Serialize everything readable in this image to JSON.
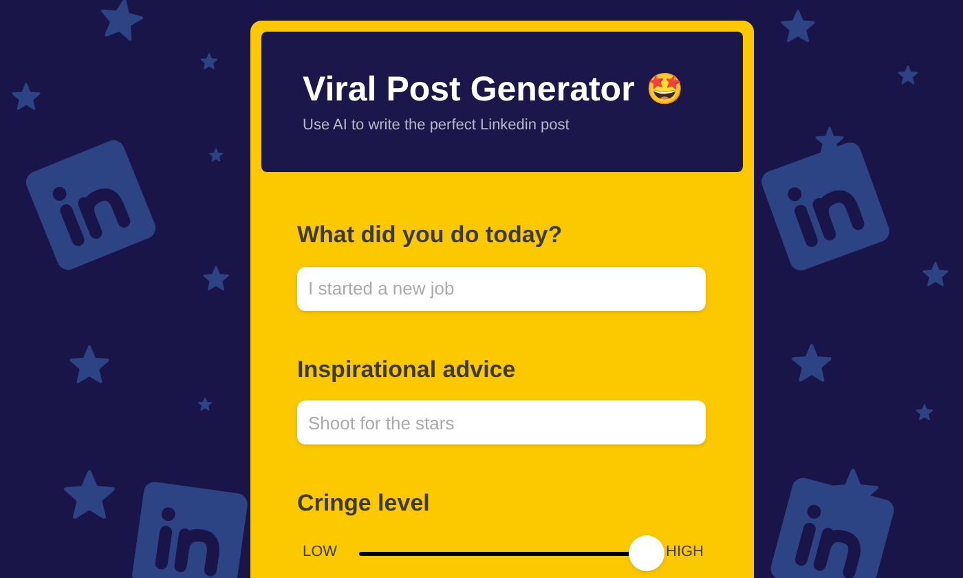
{
  "header": {
    "title": "Viral Post Generator",
    "emoji": "🤩",
    "subtitle": "Use AI to write the perfect Linkedin post"
  },
  "fields": [
    {
      "label": "What did you do today?",
      "placeholder": "I started a new job"
    },
    {
      "label": "Inspirational advice",
      "placeholder": "Shoot for the stars"
    }
  ],
  "slider": {
    "label": "Cringe level",
    "min_label": "LOW",
    "max_label": "HIGH",
    "level": 1
  }
}
